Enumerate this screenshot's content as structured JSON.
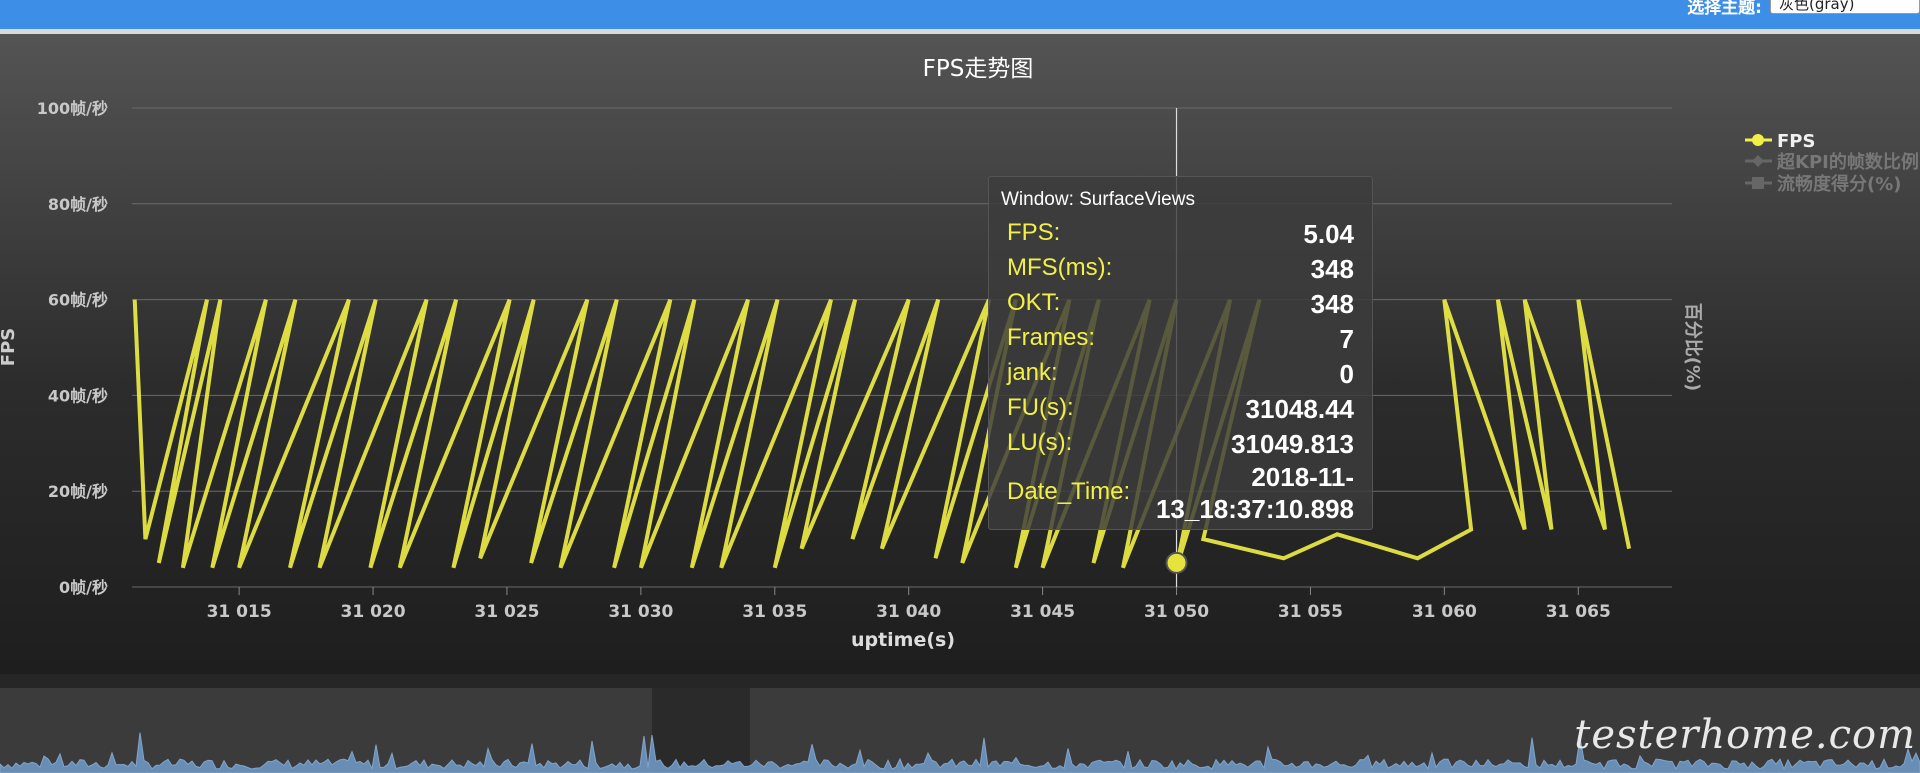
{
  "header": {
    "theme_label": "选择主题:",
    "theme_value": "灰色(gray)"
  },
  "chart_data": {
    "type": "line",
    "title": "FPS走势图",
    "xlabel": "uptime(s)",
    "ylabel": "FPS",
    "y2label": "百分比(%)",
    "xlim": [
      31011,
      31068.5
    ],
    "ylim": [
      0,
      100
    ],
    "x_ticks": [
      31015,
      31020,
      31025,
      31030,
      31035,
      31040,
      31045,
      31050,
      31055,
      31060,
      31065
    ],
    "x_tick_labels": [
      "31 015",
      "31 020",
      "31 025",
      "31 030",
      "31 035",
      "31 040",
      "31 045",
      "31 050",
      "31 055",
      "31 060",
      "31 065"
    ],
    "y_ticks": [
      0,
      20,
      40,
      60,
      80,
      100
    ],
    "y_tick_labels": [
      "0帧/秒",
      "20帧/秒",
      "40帧/秒",
      "60帧/秒",
      "80帧/秒",
      "100帧/秒"
    ],
    "grid": true,
    "legend_position": "top-right",
    "legend": [
      "FPS",
      "超KPI的帧数比例",
      "流畅度得分(%)"
    ],
    "series": [
      {
        "name": "FPS",
        "color": "#f2f046",
        "x": [
          31011.1,
          31011.5,
          31013.8,
          31012.0,
          31014.3,
          31012.9,
          31016.0,
          31014.0,
          31017.1,
          31015.0,
          31019.1,
          31016.9,
          31020.1,
          31018.0,
          31022.0,
          31019.9,
          31023.1,
          31021.0,
          31025.1,
          31023.0,
          31026.0,
          31024.0,
          31028.0,
          31025.9,
          31029.1,
          31027.0,
          31031.1,
          31029.0,
          31032.0,
          31030.0,
          31034.0,
          31031.9,
          31035.1,
          31033.0,
          31037.1,
          31035.0,
          31038.0,
          31036.0,
          31040.0,
          31037.9,
          31041.1,
          31039.0,
          31043.0,
          31041.0,
          31044.0,
          31042.0,
          31046.0,
          31044.0,
          31047.1,
          31045.0,
          31049.0,
          31046.9,
          31050.0,
          31048.0,
          31052.0,
          31050.0,
          31053.1,
          31051.0,
          31054.0,
          31056.0,
          31059.0,
          31061.0,
          31060.0,
          31063.0,
          31062.0,
          31064.0,
          31063.0,
          31066.0,
          31065.0,
          31066.9
        ],
        "y": [
          60,
          10,
          60,
          5,
          60,
          4,
          60,
          4,
          60,
          4,
          60,
          4,
          60,
          4,
          60,
          4,
          60,
          4,
          60,
          4,
          60,
          6,
          60,
          5,
          60,
          4,
          60,
          4,
          60,
          4,
          60,
          4,
          60,
          4,
          60,
          4,
          60,
          8,
          60,
          10,
          60,
          8,
          60,
          6,
          60,
          5,
          60,
          4,
          60,
          4,
          60,
          5,
          60,
          4,
          60,
          4,
          60,
          10,
          6,
          11,
          6,
          12,
          60,
          12,
          60,
          12,
          60,
          12,
          60,
          8
        ]
      }
    ]
  },
  "tooltip": {
    "title": "Window: SurfaceViews",
    "rows": [
      {
        "label": "FPS:",
        "value": "5.04"
      },
      {
        "label": "MFS(ms):",
        "value": "348"
      },
      {
        "label": "OKT:",
        "value": "348"
      },
      {
        "label": "Frames:",
        "value": "7"
      },
      {
        "label": "jank:",
        "value": "0"
      },
      {
        "label": "FU(s):",
        "value": "31048.44"
      },
      {
        "label": "LU(s):",
        "value": "31049.813"
      },
      {
        "label": "Date_Time:",
        "value": "2018-11-13_18:37:10.898"
      }
    ],
    "date_line1": "2018-11-",
    "date_line2": "13_18:37:10.898",
    "hover_x": 31050,
    "hover_y": 5.04
  },
  "watermark": "testerhome.com"
}
